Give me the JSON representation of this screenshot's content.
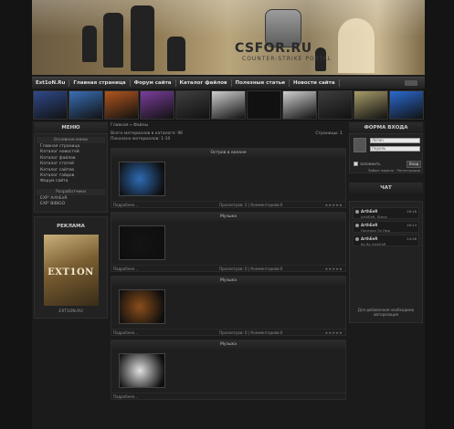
{
  "banner": {
    "logo_text": "CSFOR.RU",
    "logo_sub": "COUNTER-STRIKE PORTAL"
  },
  "nav": {
    "items": [
      "Ext1oN.Ru",
      "Главная страница",
      "Форум сайта",
      "Каталог файлов",
      "Полезные статьи",
      "Новости сайта"
    ]
  },
  "thumbs": {
    "colors": [
      "#2f4a8a",
      "#3a6fb7",
      "#b2561e",
      "#7b3d9c",
      "#3f3f3f",
      "#cfcfcf",
      "#111111",
      "#d0d0d0",
      "#3d3d3d",
      "#a89c6a",
      "#2a6ad0"
    ]
  },
  "left": {
    "menu_title": "МЕНЮ",
    "main_head": "Основное меню",
    "links": [
      "Главная страница",
      "Каталог новостей",
      "Каталог файлов",
      "Каталог статей",
      "Каталог сайтов",
      "Каталог гайдов",
      "Форум сайта"
    ],
    "dev_head": "Разработчики",
    "dev_links": [
      "EXP' ArthEeR",
      "EXP' BIBIGO"
    ],
    "ad_title": "РЕКЛАМА",
    "ad_image_text": "EXT1ON",
    "ad_caption": "EXT1ON.RU"
  },
  "main": {
    "breadcrumb": "Главная » Файлы",
    "stats_line1": "Всего материалов в каталоге: 96",
    "stats_line2": "Показано материалов: 1-10",
    "pages": "Страницы: 1",
    "entries": [
      {
        "title": "Остров в океане",
        "img_color": "#2d6bb3",
        "more": "Подробнее...",
        "views": "Просмотров: 2 | Комментариев:0",
        "stars": "★★★★★"
      },
      {
        "title": "Музыка",
        "img_color": "#141414",
        "more": "Подробнее...",
        "views": "Просмотров: 0 | Комментариев:0",
        "stars": "★★★★★"
      },
      {
        "title": "Музыка",
        "img_color": "#8a4d1a",
        "more": "Подробнее...",
        "views": "Просмотров: 0 | Комментариев:0",
        "stars": "★★★★★"
      },
      {
        "title": "Музыка",
        "img_color": "#e0e0e0",
        "more": "Подробнее...",
        "views": "",
        "stars": ""
      }
    ]
  },
  "right": {
    "login_title": "ФОРМА ВХОДА",
    "login_field": "Логин",
    "password_field": "Пароль",
    "remember": "запомнить",
    "login_button": "Вход",
    "login_links": "Забыл пароль · Регистрация",
    "chat_title": "ЧАТ",
    "messages": [
      {
        "user": "ArthEeR",
        "time": "16:18",
        "text": "ArthEeR, Steve"
      },
      {
        "user": "ArthEeR",
        "time": "16:14",
        "text": "Песенка Ти Лмр"
      },
      {
        "user": "ArthEeR",
        "time": "14:38",
        "text": "By By ArthEeR"
      }
    ],
    "chat_note_1": "Для добавления необходима",
    "chat_note_2": "авторизация"
  }
}
